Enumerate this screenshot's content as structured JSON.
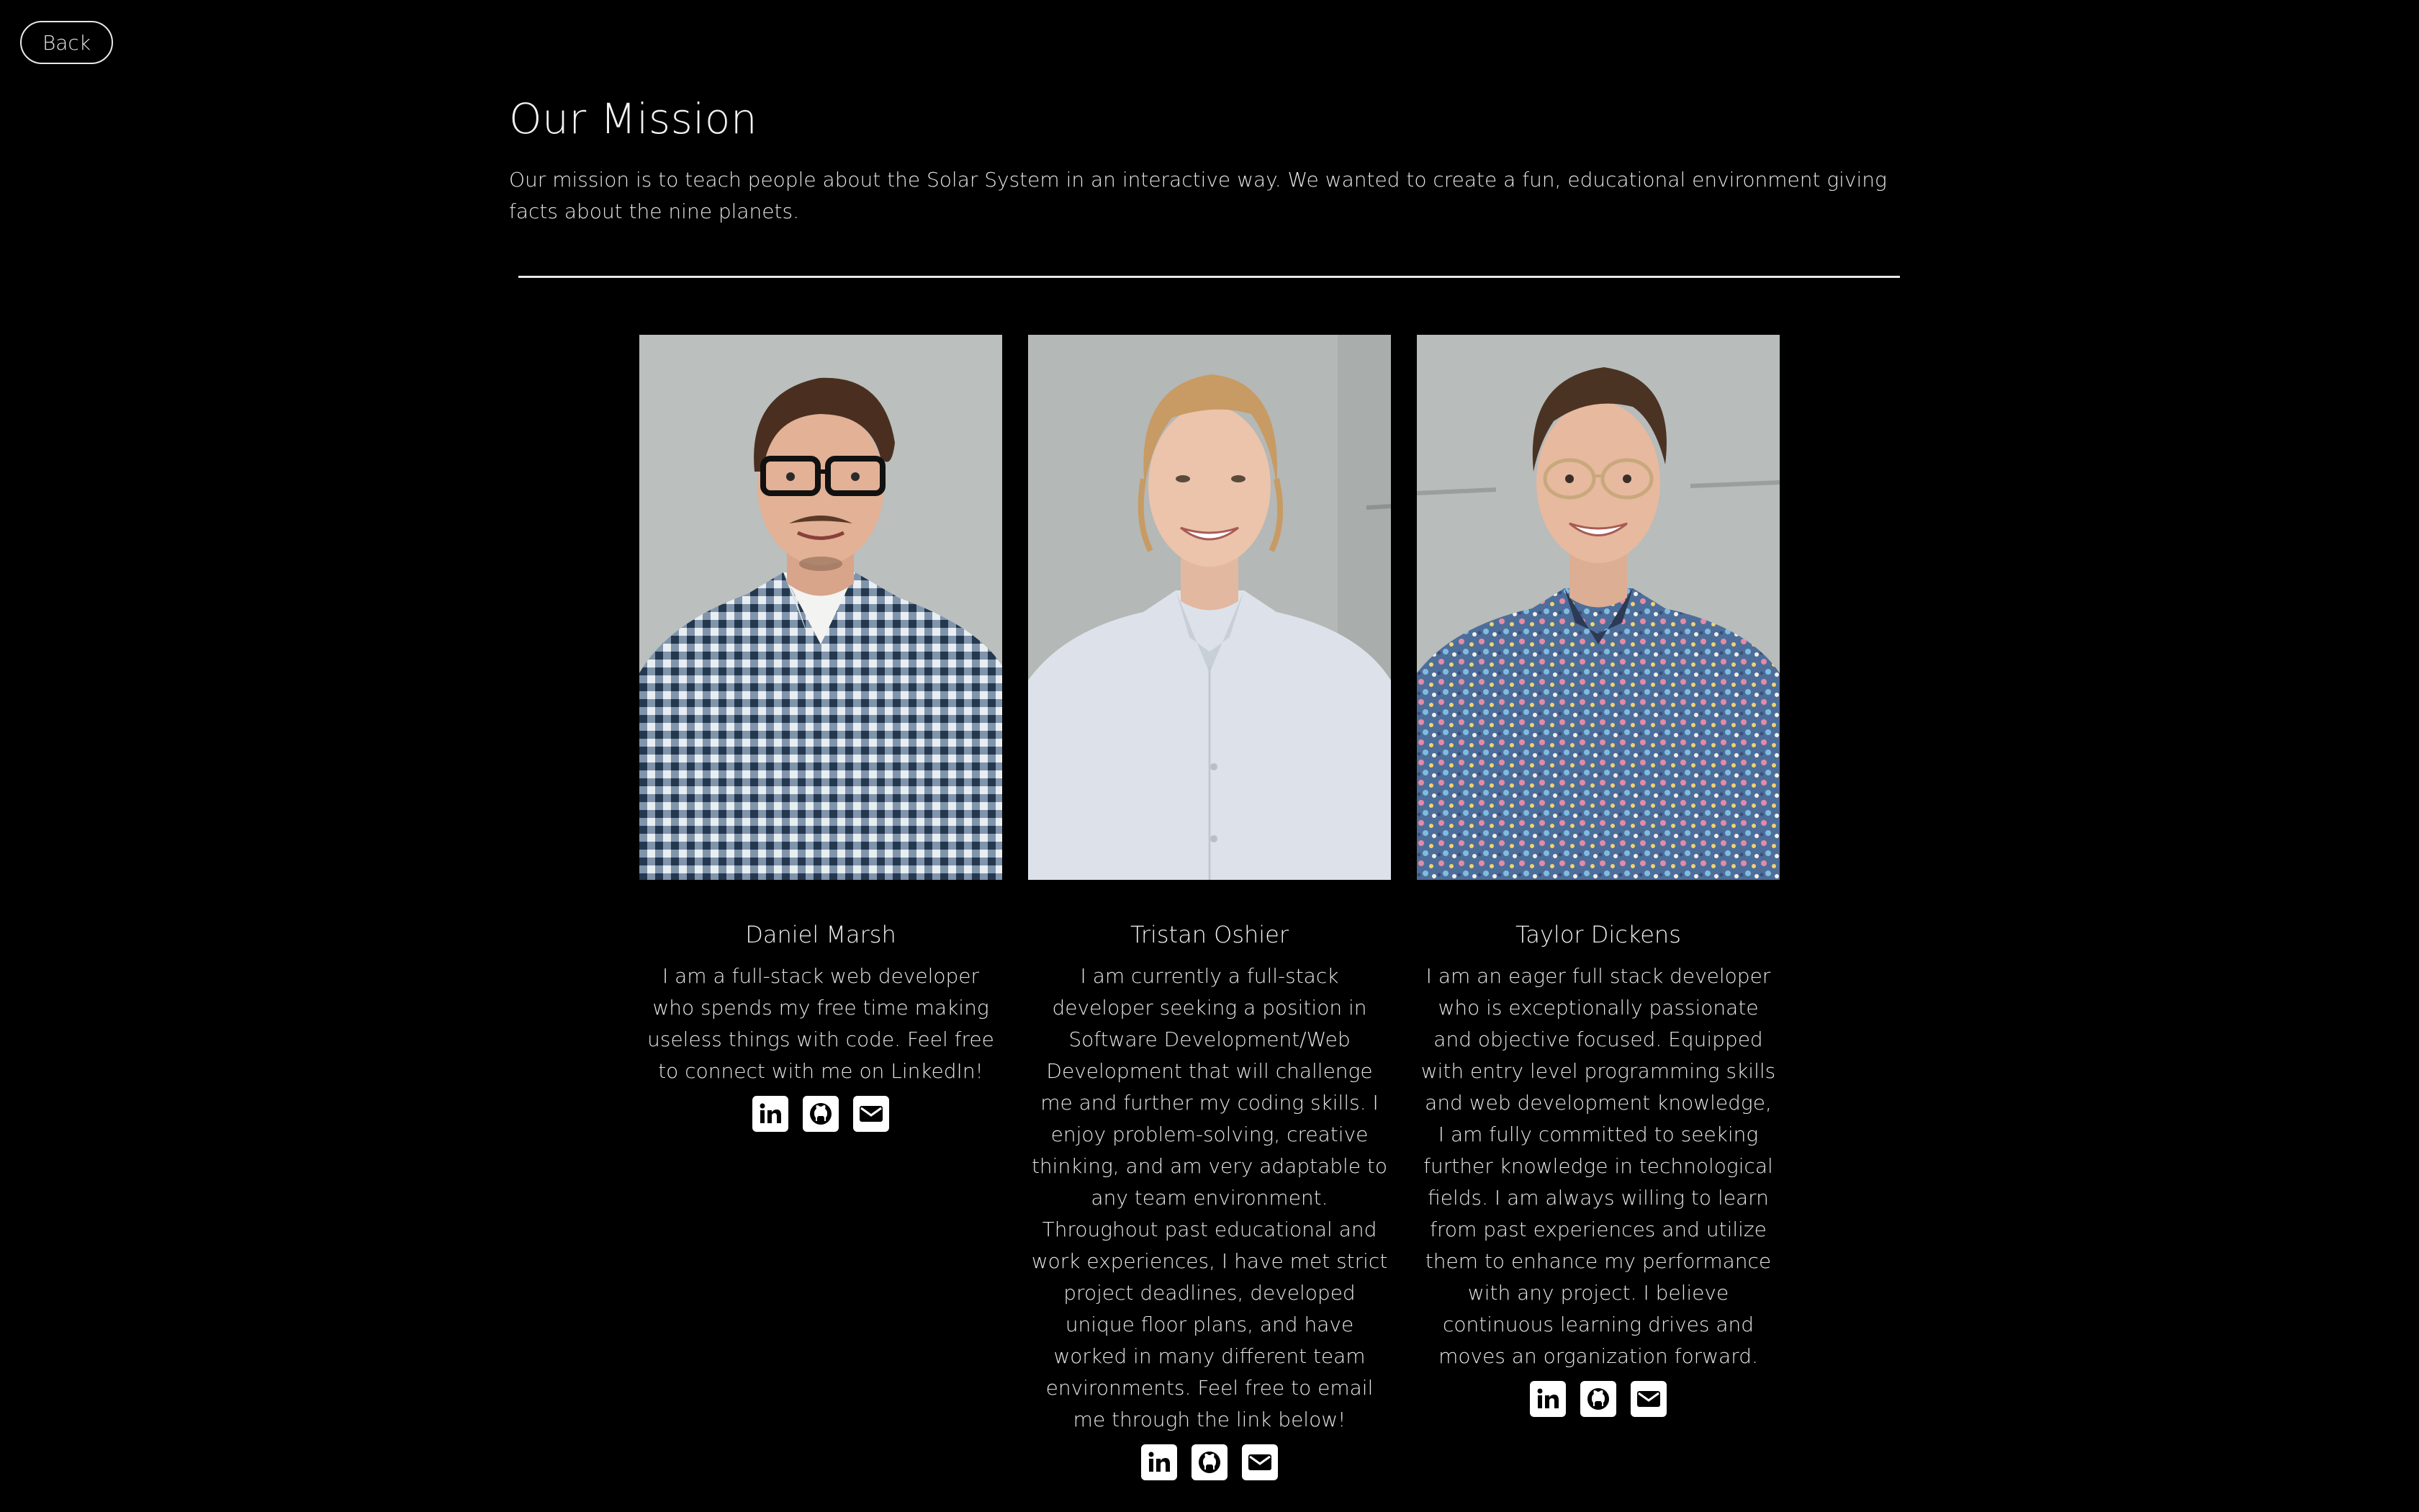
{
  "nav": {
    "back_label": "Back"
  },
  "mission": {
    "title": "Our Mission",
    "text": "Our mission is to teach people about the Solar System in an interactive way. We wanted to create a fun, educational environment giving facts about the nine planets."
  },
  "team": [
    {
      "name": "Daniel Marsh",
      "bio": "I am a full-stack web developer who spends my free time making useless things with code. Feel free to connect with me on LinkedIn!",
      "links": [
        "linkedin-icon",
        "github-icon",
        "email-icon"
      ]
    },
    {
      "name": "Tristan Oshier",
      "bio": "I am currently a full-stack developer seeking a position in Software Development/Web Development that will challenge me and further my coding skills. I enjoy problem-solving, creative thinking, and am very adaptable to any team environment. Throughout past educational and work experiences, I have met strict project deadlines, developed unique floor plans, and have worked in many different team environments. Feel free to email me through the link below!",
      "links": [
        "linkedin-icon",
        "github-icon",
        "email-icon"
      ]
    },
    {
      "name": "Taylor Dickens",
      "bio": "I am an eager full stack developer who is exceptionally passionate and objective focused. Equipped with entry level programming skills and web development knowledge, I am fully committed to seeking further knowledge in technological fields. I am always willing to learn from past experiences and utilize them to enhance my performance with any project. I believe continuous learning drives and moves an organization forward.",
      "links": [
        "linkedin-icon",
        "github-icon",
        "email-icon"
      ]
    }
  ],
  "colors": {
    "background": "#000000",
    "text": "#e6e6e6",
    "accent": "#ffffff"
  }
}
